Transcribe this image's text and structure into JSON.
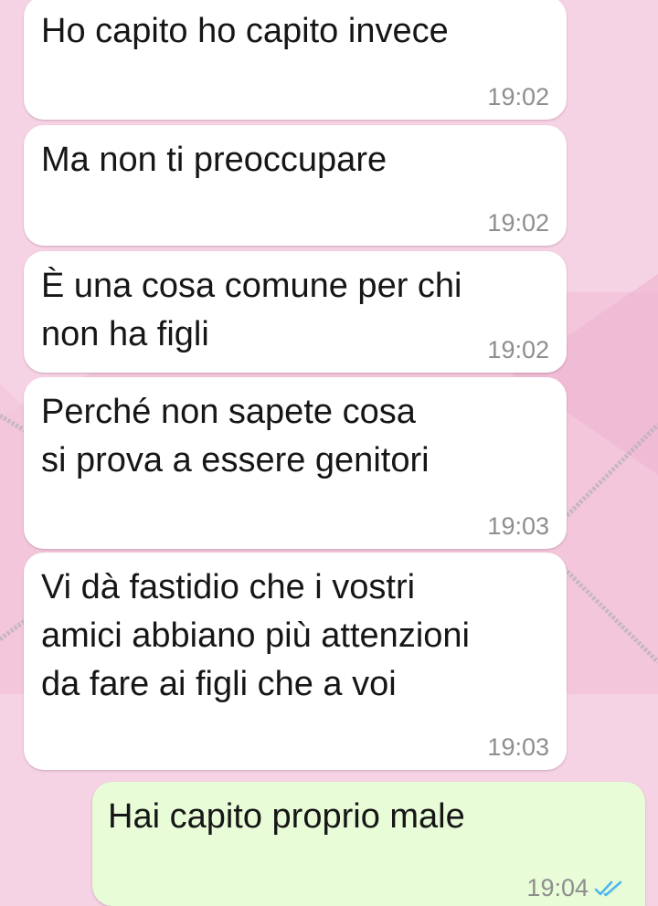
{
  "theme": {
    "wallpaper_color": "#f6d3e4",
    "wallpaper_panel_color": "#f0bcd4",
    "incoming_bubble_color": "#ffffff",
    "outgoing_bubble_color": "#e8fcd8",
    "read_tick_color": "#4fb6ec"
  },
  "messages": [
    {
      "direction": "incoming",
      "text": "Ho capito ho capito invece",
      "time": "19:02"
    },
    {
      "direction": "incoming",
      "text": "Ma non ti preoccupare",
      "time": "19:02"
    },
    {
      "direction": "incoming",
      "text": "È una cosa comune per chi\nnon ha figli",
      "time": "19:02"
    },
    {
      "direction": "incoming",
      "text": "Perché non sapete cosa\nsi prova a essere genitori",
      "time": "19:03"
    },
    {
      "direction": "incoming",
      "text": "Vi dà fastidio che i vostri\namici abbiano più attenzioni\nda fare ai figli che a voi",
      "time": "19:03"
    },
    {
      "direction": "outgoing",
      "text": "Hai capito proprio male",
      "time": "19:04",
      "status_icon": "double-check-read-icon"
    }
  ]
}
